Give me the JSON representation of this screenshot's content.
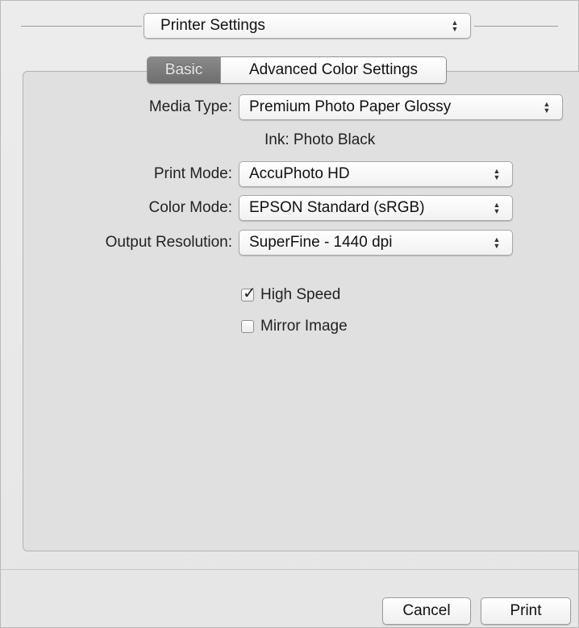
{
  "section_popup": {
    "value": "Printer Settings"
  },
  "tabs": [
    {
      "label": "Basic",
      "selected": true
    },
    {
      "label": "Advanced Color Settings",
      "selected": false
    }
  ],
  "form": {
    "media_type": {
      "label": "Media Type:",
      "value": "Premium Photo Paper Glossy"
    },
    "ink": "Ink:  Photo Black",
    "print_mode": {
      "label": "Print Mode:",
      "value": "AccuPhoto HD"
    },
    "color_mode": {
      "label": "Color Mode:",
      "value": "EPSON Standard (sRGB)"
    },
    "output_resolution": {
      "label": "Output Resolution:",
      "value": "SuperFine - 1440 dpi"
    },
    "high_speed": {
      "label": "High Speed",
      "checked": true
    },
    "mirror_image": {
      "label": "Mirror Image",
      "checked": false
    }
  },
  "buttons": {
    "cancel": "Cancel",
    "print": "Print"
  },
  "icons": {
    "updown": "updown-arrows-icon",
    "check": "checkmark-icon"
  }
}
